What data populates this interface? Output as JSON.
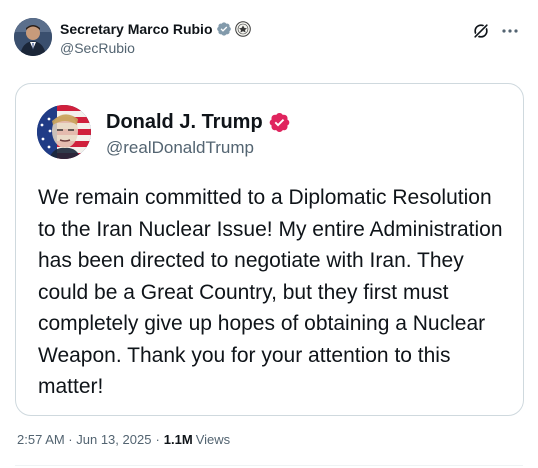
{
  "post": {
    "author_name": "Secretary Marco Rubio",
    "author_handle": "@SecRubio",
    "timestamp": "2:57 AM · Jun 13, 2025",
    "separator": "·",
    "views_count": "1.1M",
    "views_label": "Views"
  },
  "quoted_post": {
    "author_name": "Donald J. Trump",
    "author_handle": "@realDonaldTrump",
    "text": "We remain committed to a Diplomatic Resolution to the Iran Nuclear Issue! My entire Administration has been directed to negotiate with Iran. They could be a Great Country, but they first must completely give up hopes of obtaining a Nuclear Weapon. Thank you for your attention to this matter!"
  },
  "icons": {
    "verified_gray": "verified-badge-icon",
    "gov_seal": "government-seal-icon",
    "grok": "grok-icon",
    "more": "more-options-icon",
    "verified_pink": "verified-badge-icon"
  },
  "colors": {
    "text_primary": "#0f1419",
    "text_secondary": "#536471",
    "border": "#cfd9de",
    "verified_gray": "#829aab",
    "verified_pink": "#e0245e"
  }
}
